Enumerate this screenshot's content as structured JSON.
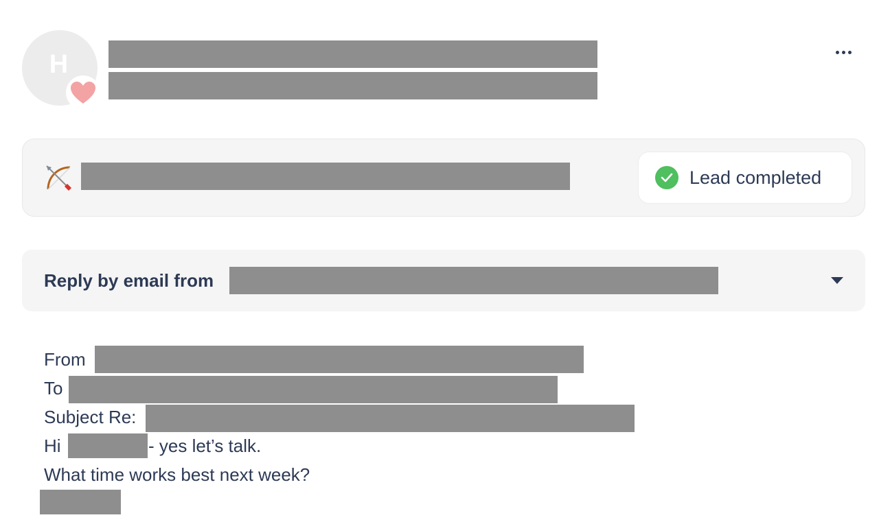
{
  "contact": {
    "avatar_initial": "H"
  },
  "icons": {
    "heart": "heart-icon",
    "more": "more-horizontal-icon",
    "bow": "bow-and-arrow-icon",
    "check": "check-circle-icon",
    "caret": "caret-down-icon"
  },
  "colors": {
    "text": "#2d3a55",
    "success": "#4fbf5f",
    "heart": "#f3a3a3",
    "panel": "#f5f5f5",
    "redaction": "#8e8e8e"
  },
  "lead": {
    "status_label": "Lead completed"
  },
  "reply": {
    "title": "Reply by email from"
  },
  "email": {
    "from_label": "From",
    "to_label": "To",
    "subject_label": "Subject Re:",
    "greeting": "Hi",
    "greeting_rest": "- yes let’s talk.",
    "body_line": "What time works best next week?"
  }
}
